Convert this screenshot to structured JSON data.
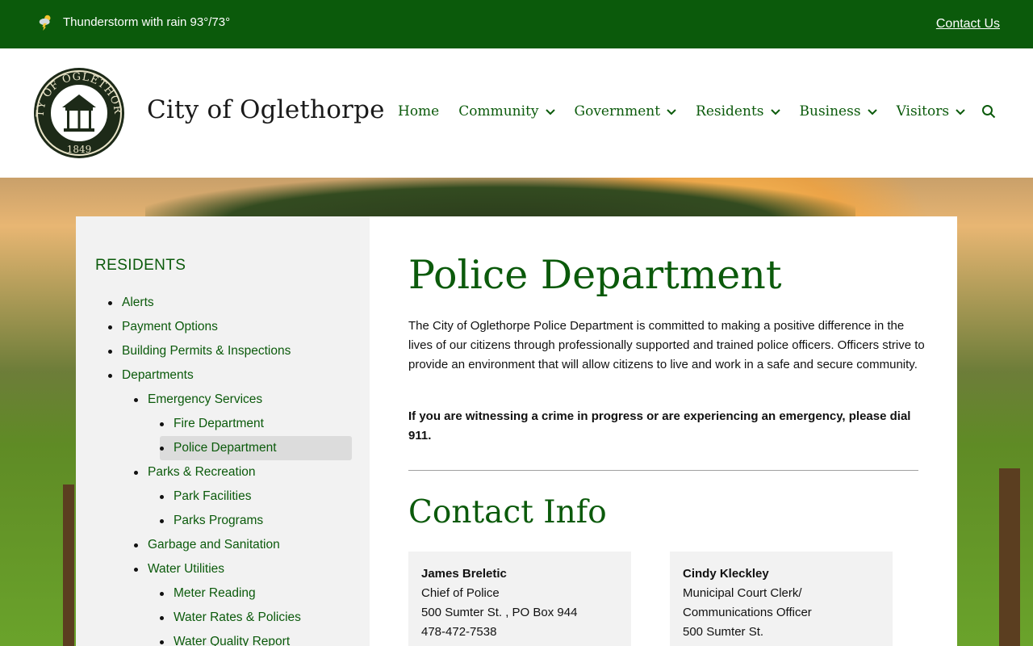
{
  "topbar": {
    "weather_text": "Thunderstorm with rain 93°/73°",
    "contact_label": "Contact Us",
    "weather_icon": "thunderstorm-icon"
  },
  "header": {
    "seal_text_top": "CITY OF OGLETHORPE",
    "seal_year": "1849",
    "site_title": "City of Oglethorpe",
    "nav": [
      {
        "label": "Home",
        "dropdown": false
      },
      {
        "label": "Community",
        "dropdown": true
      },
      {
        "label": "Government",
        "dropdown": true
      },
      {
        "label": "Residents",
        "dropdown": true
      },
      {
        "label": "Business",
        "dropdown": true
      },
      {
        "label": "Visitors",
        "dropdown": true
      }
    ]
  },
  "sidebar": {
    "heading": "RESIDENTS",
    "items": [
      {
        "label": "Alerts",
        "level": 1
      },
      {
        "label": "Payment Options",
        "level": 1
      },
      {
        "label": "Building Permits & Inspections",
        "level": 1
      },
      {
        "label": "Departments",
        "level": 1
      },
      {
        "label": "Emergency Services",
        "level": 2
      },
      {
        "label": "Fire Department",
        "level": 3
      },
      {
        "label": "Police Department",
        "level": 3,
        "active": true
      },
      {
        "label": "Parks & Recreation",
        "level": 2
      },
      {
        "label": "Park Facilities",
        "level": 3
      },
      {
        "label": "Parks Programs",
        "level": 3
      },
      {
        "label": "Garbage and Sanitation",
        "level": 2
      },
      {
        "label": "Water Utilities",
        "level": 2
      },
      {
        "label": "Meter Reading",
        "level": 3
      },
      {
        "label": "Water Rates & Policies",
        "level": 3
      },
      {
        "label": "Water Quality Report",
        "level": 3
      }
    ]
  },
  "content": {
    "title": "Police Department",
    "intro": "The City of Oglethorpe Police Department is committed to making a positive difference in the lives of our citizens through professionally supported and trained police officers. Officers strive to provide an environment that will allow citizens to live and work in a safe and secure community.",
    "emergency": "If you are witnessing a crime in progress or are experiencing an emergency, please dial 911.",
    "contact_title": "Contact Info",
    "cards": [
      {
        "name": "James Breletic",
        "lines": [
          "Chief of Police",
          "500 Sumter St. , PO Box 944",
          "478-472-7538"
        ]
      },
      {
        "name": "Cindy Kleckley",
        "lines": [
          "Municipal Court Clerk/",
          "Communications Officer",
          "500 Sumter St."
        ]
      }
    ]
  },
  "colors": {
    "brand_green": "#0b5a0b",
    "sidebar_bg": "#f2f2f2",
    "active_item_bg": "#dcdcdc"
  }
}
